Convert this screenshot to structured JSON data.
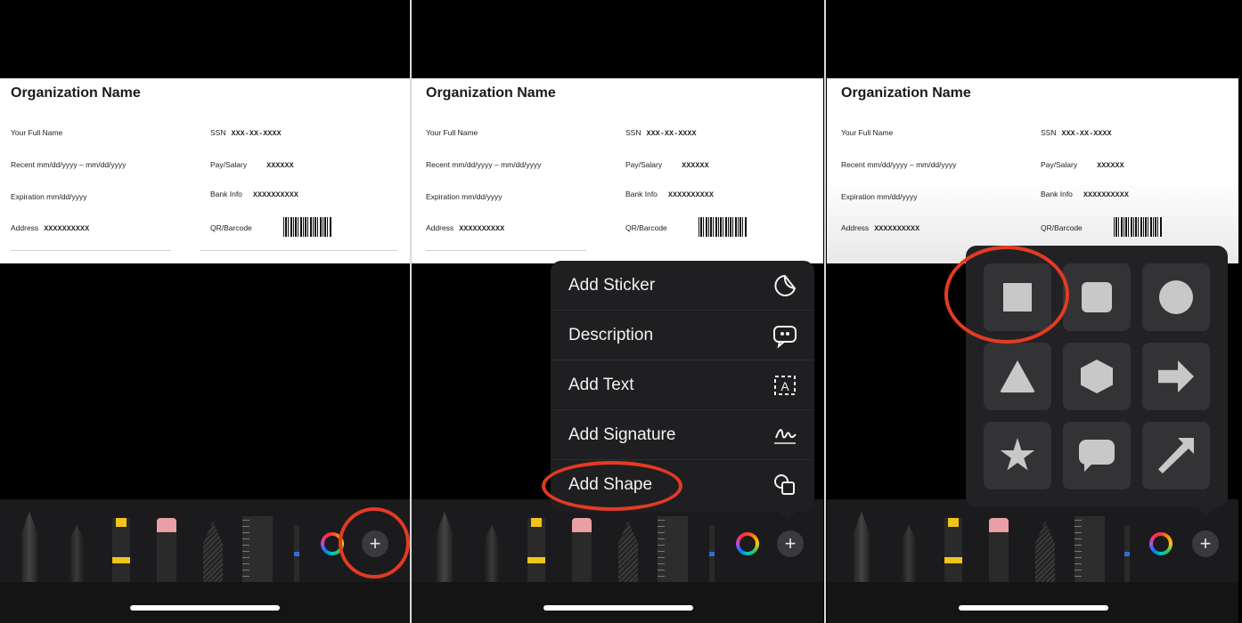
{
  "document": {
    "title": "Organization Name",
    "name_label": "Your Full Name",
    "recent_label": "Recent mm/dd/yyyy – mm/dd/yyyy",
    "expiration_label": "Expiration mm/dd/yyyy",
    "address_label": "Address",
    "address_value": "XXXXXXXXXX",
    "ssn_label": "SSN",
    "ssn_value": "XXX-XX-XXXX",
    "pay_label": "Pay/Salary",
    "pay_value": "XXXXXX",
    "bank_label": "Bank Info",
    "bank_value": "XXXXXXXXXX",
    "qr_label": "QR/Barcode"
  },
  "toolbar": {
    "tools": [
      "pen-icon",
      "pencil-icon",
      "marker-icon",
      "eraser-icon",
      "lasso-icon",
      "ruler-icon",
      "thin-pen-icon"
    ],
    "add_label": "+"
  },
  "menu": {
    "items": [
      {
        "label": "Add Sticker",
        "icon": "sticker-icon"
      },
      {
        "label": "Description",
        "icon": "speech-quote-icon"
      },
      {
        "label": "Add Text",
        "icon": "text-box-icon"
      },
      {
        "label": "Add Signature",
        "icon": "signature-icon"
      },
      {
        "label": "Add Shape",
        "icon": "shapes-icon"
      }
    ]
  },
  "shapes": [
    "square",
    "rounded-square",
    "circle",
    "triangle",
    "hexagon",
    "right-arrow",
    "star",
    "speech-bubble",
    "diagonal-arrow"
  ],
  "colors": {
    "highlight": "#e33b22",
    "marker": "#f0c419",
    "eraser": "#e8a0a4"
  }
}
